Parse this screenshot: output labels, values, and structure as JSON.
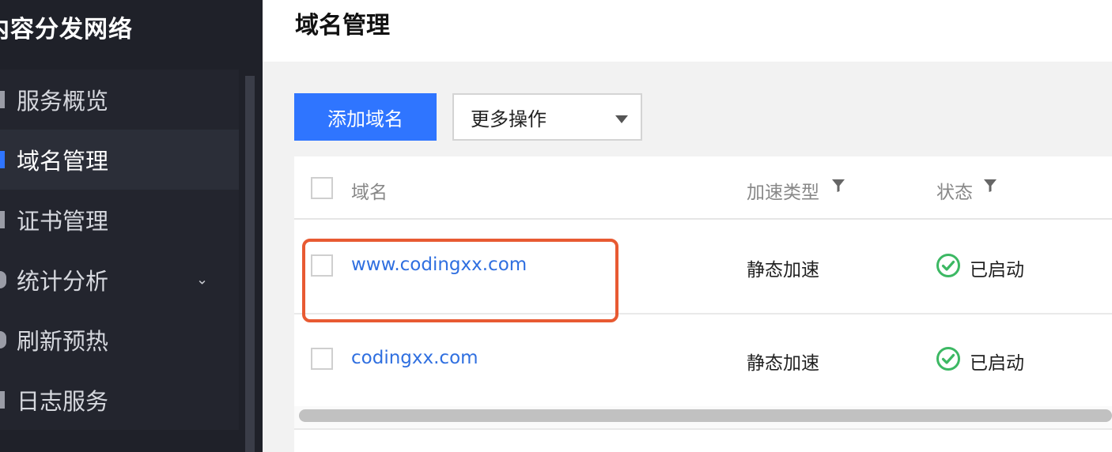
{
  "sidebar": {
    "brand": "内容分发网络",
    "items": [
      {
        "label": "服务概览",
        "active": false,
        "icon": "overview-icon"
      },
      {
        "label": "域名管理",
        "active": true,
        "icon": "domain-icon"
      },
      {
        "label": "证书管理",
        "active": false,
        "icon": "certificate-icon"
      },
      {
        "label": "统计分析",
        "active": false,
        "icon": "stats-icon",
        "chevron": "⌄"
      },
      {
        "label": "刷新预热",
        "active": false,
        "icon": "refresh-icon"
      },
      {
        "label": "日志服务",
        "active": false,
        "icon": "log-icon"
      }
    ]
  },
  "header": {
    "title": "域名管理"
  },
  "toolbar": {
    "add_label": "添加域名",
    "more_label": "更多操作"
  },
  "table": {
    "columns": [
      {
        "label": "域名"
      },
      {
        "label": "加速类型",
        "filter_icon": "filter-icon"
      },
      {
        "label": "状态",
        "filter_icon": "filter-icon"
      }
    ],
    "rows": [
      {
        "domain": "www.codingxx.com",
        "type": "静态加速",
        "status": "已启动",
        "highlighted": true
      },
      {
        "domain": "codingxx.com",
        "type": "静态加速",
        "status": "已启动",
        "highlighted": false
      }
    ]
  },
  "colors": {
    "accent": "#2f75ff",
    "status_ok": "#3cb863",
    "highlight": "#e85a32",
    "sidebar_bg": "#1f2129"
  }
}
